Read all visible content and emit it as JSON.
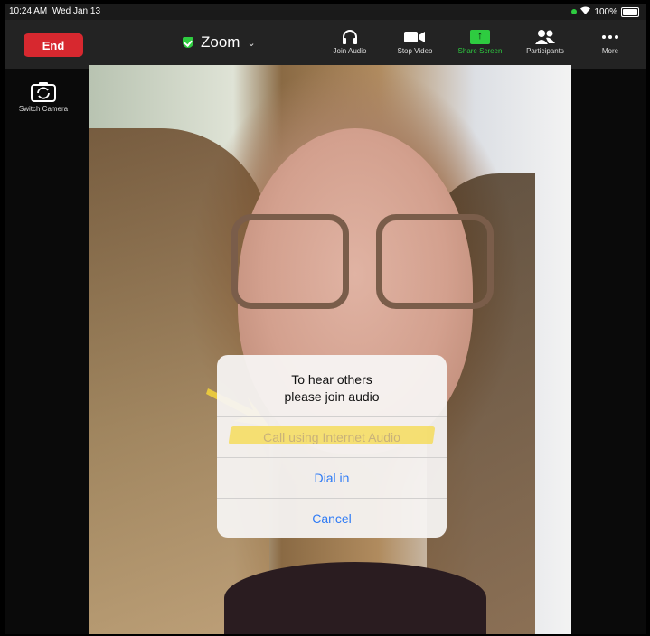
{
  "status_bar": {
    "time": "10:24 AM",
    "date": "Wed Jan 13",
    "battery": "100%"
  },
  "toolbar": {
    "end_label": "End",
    "meeting_title": "Zoom",
    "tools": [
      {
        "label": "Join Audio",
        "icon": "headphones-icon"
      },
      {
        "label": "Stop Video",
        "icon": "video-camera-icon"
      },
      {
        "label": "Share Screen",
        "icon": "share-screen-icon"
      },
      {
        "label": "Participants",
        "icon": "participants-icon"
      },
      {
        "label": "More",
        "icon": "more-dots-icon"
      }
    ]
  },
  "sidebar": {
    "switch_camera_label": "Switch Camera"
  },
  "dialog": {
    "message_line1": "To hear others",
    "message_line2": "please join audio",
    "options": [
      "Call using Internet Audio",
      "Dial in",
      "Cancel"
    ]
  },
  "colors": {
    "end_button": "#d7282f",
    "accent_green": "#2ecc40",
    "ios_blue": "#2f7bf5",
    "highlight_yellow": "#f5da4a"
  }
}
